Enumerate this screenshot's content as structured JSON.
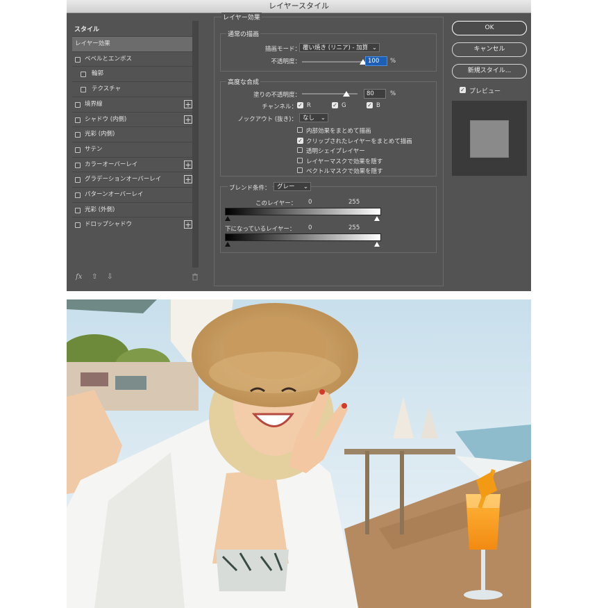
{
  "dialog": {
    "title": "レイヤースタイル",
    "sidebar": {
      "header": "スタイル",
      "items": [
        {
          "label": "レイヤー効果",
          "checkbox": false,
          "plus": false,
          "selected": true,
          "indent": false
        },
        {
          "label": "ベベルとエンボス",
          "checkbox": true,
          "plus": false,
          "selected": false,
          "indent": false
        },
        {
          "label": "輪郭",
          "checkbox": true,
          "plus": false,
          "selected": false,
          "indent": true
        },
        {
          "label": "テクスチャ",
          "checkbox": true,
          "plus": false,
          "selected": false,
          "indent": true
        },
        {
          "label": "境界線",
          "checkbox": true,
          "plus": true,
          "selected": false,
          "indent": false
        },
        {
          "label": "シャドウ (内側)",
          "checkbox": true,
          "plus": true,
          "selected": false,
          "indent": false
        },
        {
          "label": "光彩 (内側)",
          "checkbox": true,
          "plus": false,
          "selected": false,
          "indent": false
        },
        {
          "label": "サテン",
          "checkbox": true,
          "plus": false,
          "selected": false,
          "indent": false
        },
        {
          "label": "カラーオーバーレイ",
          "checkbox": true,
          "plus": true,
          "selected": false,
          "indent": false
        },
        {
          "label": "グラデーションオーバーレイ",
          "checkbox": true,
          "plus": true,
          "selected": false,
          "indent": false
        },
        {
          "label": "パターンオーバーレイ",
          "checkbox": true,
          "plus": false,
          "selected": false,
          "indent": false
        },
        {
          "label": "光彩 (外側)",
          "checkbox": true,
          "plus": false,
          "selected": false,
          "indent": false
        },
        {
          "label": "ドロップシャドウ",
          "checkbox": true,
          "plus": true,
          "selected": false,
          "indent": false
        }
      ],
      "footer_icons": [
        "fx-icon",
        "move-up-icon",
        "move-down-icon",
        "trash-icon"
      ],
      "fx_label": "fx"
    },
    "main": {
      "section_title": "レイヤー効果",
      "normal_blend": {
        "title": "通常の描画",
        "blend_mode_label": "描画モード：",
        "blend_mode_value": "覆い焼き (リニア) - 加算",
        "opacity_label": "不透明度：",
        "opacity_value": "100",
        "opacity_fraction": 1.0,
        "percent": "%"
      },
      "advanced_blend": {
        "title": "高度な合成",
        "fill_opacity_label": "塗りの不透明度：",
        "fill_opacity_value": "80",
        "fill_opacity_fraction": 0.8,
        "percent": "%",
        "channels_label": "チャンネル：",
        "channels": [
          {
            "label": "R",
            "checked": true
          },
          {
            "label": "G",
            "checked": true
          },
          {
            "label": "B",
            "checked": true
          }
        ],
        "knockout_label": "ノックアウト (抜き)：",
        "knockout_value": "なし",
        "options": [
          {
            "label": "内部効果をまとめて描画",
            "checked": false
          },
          {
            "label": "クリップされたレイヤーをまとめて描画",
            "checked": true
          },
          {
            "label": "透明シェイプレイヤー",
            "checked": false
          },
          {
            "label": "レイヤーマスクで効果を隠す",
            "checked": false
          },
          {
            "label": "ベクトルマスクで効果を隠す",
            "checked": false
          }
        ]
      },
      "blend_if": {
        "label": "ブレンド条件：",
        "value": "グレー",
        "this_layer_label": "このレイヤー：",
        "this_layer_min": "0",
        "this_layer_max": "255",
        "underlying_label": "下になっているレイヤー：",
        "underlying_min": "0",
        "underlying_max": "255"
      }
    },
    "buttons": {
      "ok": "OK",
      "cancel": "キャンセル",
      "new_style": "新規スタイル...",
      "preview_label": "プレビュー",
      "preview_checked": true
    },
    "colors": {
      "panel_bg": "#535353",
      "selected_bg": "#6c6c6c",
      "highlight": "#1c5fb5"
    }
  },
  "photo": {
    "subject": "woman-in-straw-hat-selfie",
    "colors": {
      "sky": "#cfe3ee",
      "hat": "#c9a066",
      "shirt": "#f3f3f1",
      "juice": "#f39c1e",
      "deck": "#b58a60"
    }
  }
}
